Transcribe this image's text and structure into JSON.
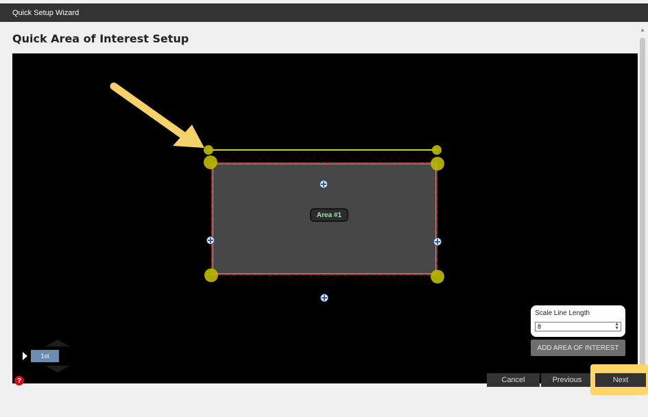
{
  "window": {
    "title": "Quick Setup Wizard"
  },
  "page": {
    "title": "Quick Area of Interest Setup"
  },
  "canvas": {
    "area_label": "Area #1",
    "layer": {
      "label": "1st"
    }
  },
  "scale_panel": {
    "label": "Scale Line Length",
    "value": "8"
  },
  "actions": {
    "add_area_label": "ADD AREA OF INTEREST"
  },
  "footer": {
    "help_glyph": "?",
    "cancel_label": "Cancel",
    "previous_label": "Previous",
    "next_label": "Next"
  },
  "colors": {
    "title_bar": "#333333",
    "canvas": "#000000",
    "area_fill": "#474747",
    "area_border": "#d11a1a",
    "handle": "#b8b800",
    "annotation_arrow": "#f7d26a",
    "next_highlight": "#ffd56a",
    "layer_chip": "#6b8cb2"
  },
  "icons": {
    "handles": "circle-handle-icon",
    "midpoints": "plus-handle-icon",
    "help": "help-icon",
    "annotation": "arrow-annotation-icon"
  }
}
